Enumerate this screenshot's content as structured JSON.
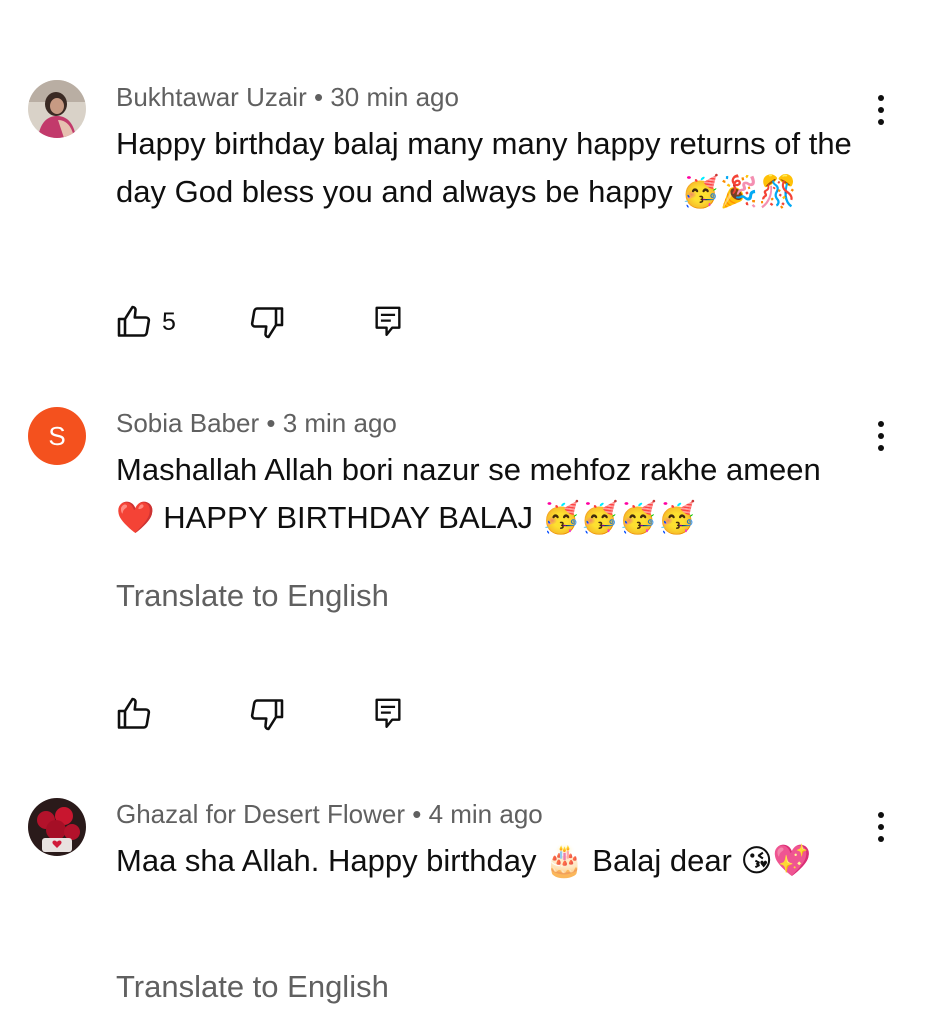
{
  "comments": [
    {
      "author": "Bukhtawar Uzair",
      "separator": "•",
      "time": "30 min ago",
      "text": "Happy birthday balaj many many happy returns of the day God bless you and always be happy 🥳🎉🎊",
      "likes": "5",
      "avatar_icon": "photo-avatar-person"
    },
    {
      "author": "Sobia Baber",
      "separator": "•",
      "time": "3 min ago",
      "text": "Mashallah Allah bori nazur se mehfoz rakhe ameen ❤️ HAPPY BIRTHDAY BALAJ 🥳🥳🥳🥳",
      "translate_label": "Translate to English",
      "avatar_letter": "S",
      "avatar_color": "#f4511e"
    },
    {
      "author": "Ghazal for Desert Flower",
      "separator": "•",
      "time": "4 min ago",
      "text": "Maa sha Allah. Happy birthday 🎂 Balaj dear 😘💖",
      "translate_label": "Translate to English",
      "avatar_icon": "photo-avatar-roses"
    }
  ],
  "colors": {
    "text_primary": "#0f0f0f",
    "text_secondary": "#606060"
  }
}
